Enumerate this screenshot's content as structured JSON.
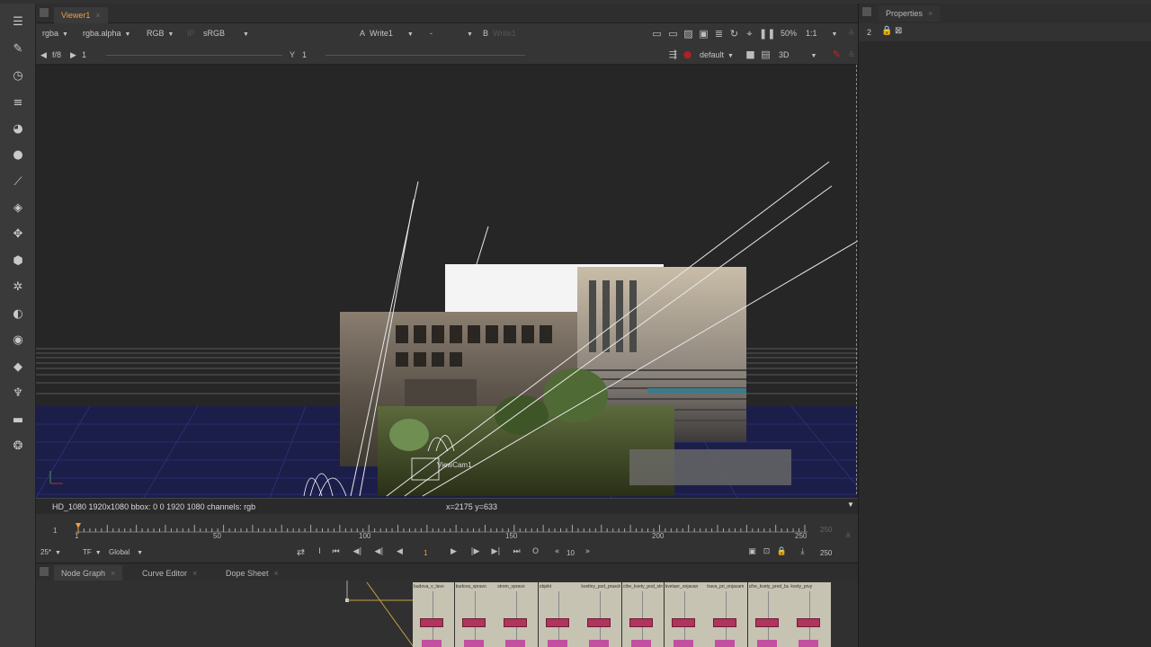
{
  "viewer_tab": {
    "label": "Viewer1"
  },
  "viewer_controls": {
    "channels": "rgba",
    "alpha": "rgba.alpha",
    "display": "RGB",
    "colorspace": "sRGB",
    "input_a_label": "A",
    "input_a": "Write1",
    "input_mid": "-",
    "input_b_label": "B",
    "input_b": "Write1",
    "zoom": "50%",
    "ratio": "1:1",
    "fstop": "f/8",
    "gain": "1",
    "gamma_label": "Y",
    "gamma": "1",
    "lut": "default",
    "mode": "3D"
  },
  "viewer": {
    "camera_label": "ViewCam1"
  },
  "infobar": {
    "format": "HD_1080 1920x1080  bbox: 0 0 1920 1080 channels: rgb",
    "coords": "x=2175 y=633"
  },
  "timeline": {
    "frame_labels": [
      "1",
      "50",
      "100",
      "150",
      "200",
      "250"
    ],
    "in_point": "1",
    "out_point": "250",
    "fps": "25*",
    "tf": "TF",
    "scope": "Global",
    "current_frame": "1",
    "step": "10",
    "end_frame": "250"
  },
  "nodegraph_tabs": [
    "Node Graph",
    "Curve Editor",
    "Dope Sheet"
  ],
  "nodes": [
    "budova_v_lavo",
    "budova_vpravo",
    "strom_vpravo",
    "objekt",
    "kvetiny_pod_prasckoulka",
    "cihe_kvety_pod_stromami",
    "kvetaer_onjavan",
    "trava_pri_onjavam",
    "cihe_kvety_pred_budovou",
    "kvety_prvy"
  ],
  "properties": {
    "tab_label": "Properties",
    "count": "2"
  },
  "colors": {
    "accent": "#f0a040",
    "node": "#b0345c",
    "ground": "#1a1c4a"
  }
}
